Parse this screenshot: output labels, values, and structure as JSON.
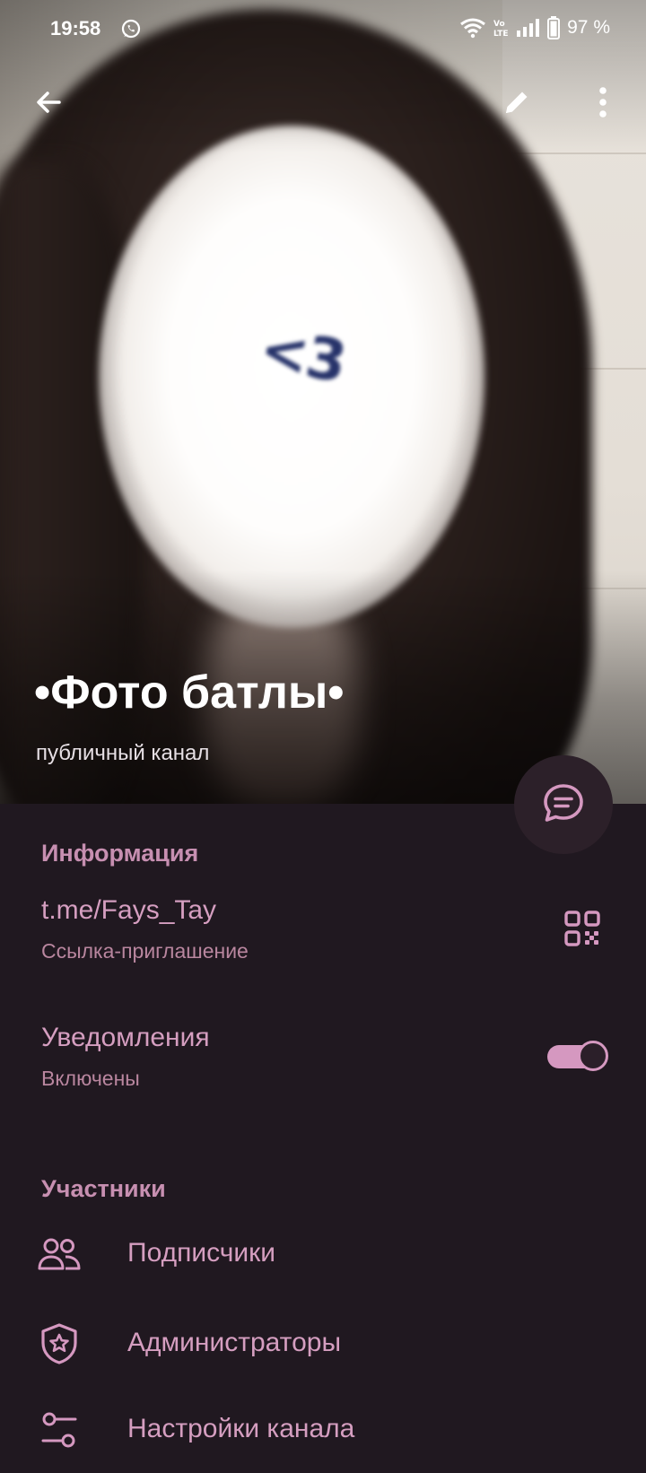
{
  "status_bar": {
    "time": "19:58",
    "battery": "97 %",
    "notification_icon": "whatsapp-icon",
    "indicators": [
      "wifi-icon",
      "volte-icon",
      "signal-icon",
      "battery-icon"
    ]
  },
  "toolbar": {
    "back_icon": "arrow-left-icon",
    "edit_icon": "pencil-icon",
    "more_icon": "more-vertical-icon"
  },
  "header": {
    "photo_caption": "<3",
    "title": "•Фото батлы•",
    "subtitle": "публичный канал"
  },
  "fab": {
    "icon": "chat-bubble-icon"
  },
  "info": {
    "section_title": "Информация",
    "link": "t.me/Fays_Tay",
    "link_label": "Ссылка-приглашение",
    "qr_icon": "qr-code-icon",
    "notifications_title": "Уведомления",
    "notifications_status": "Включены",
    "notifications_enabled": true
  },
  "members": {
    "section_title": "Участники",
    "items": [
      {
        "label": "Подписчики",
        "icon": "people-icon"
      },
      {
        "label": "Администраторы",
        "icon": "shield-star-icon"
      },
      {
        "label": "Настройки канала",
        "icon": "sliders-icon"
      }
    ]
  },
  "colors": {
    "background": "#201820",
    "accent": "#d59ec0",
    "accent_dim": "#b9869f",
    "header_accent": "#c78fb1"
  }
}
